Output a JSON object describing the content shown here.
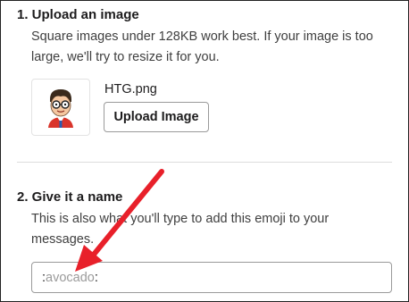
{
  "upload_section": {
    "title": "1. Upload an image",
    "description_line1": "Square images under 128KB work best. If your image is too",
    "description_line2": "large, we'll try to resize it for you.",
    "filename": "HTG.png",
    "upload_button_label": "Upload Image"
  },
  "name_section": {
    "title": "2. Give it a name",
    "description_line1": "This is also what you'll type to add this emoji to your",
    "description_line2": "messages.",
    "name_input": {
      "prefix": ":",
      "placeholder": "avocado",
      "suffix": ":"
    }
  },
  "colors": {
    "annotation_arrow": "#e8202a",
    "text": "#1d1c1d",
    "placeholder": "#9b9b9b"
  },
  "icons": {
    "preview_image": "htg-avatar-icon",
    "annotation": "red-arrow-icon"
  }
}
